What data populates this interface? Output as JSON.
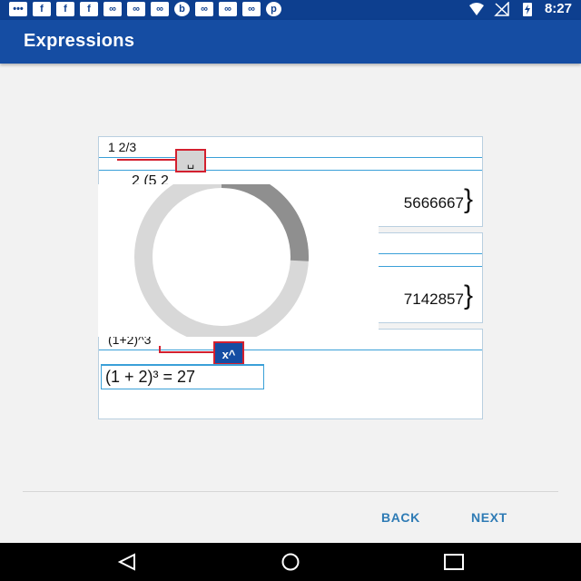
{
  "status_bar": {
    "left_icons": [
      "message-icon",
      "facebook-icon",
      "facebook-icon",
      "facebook-icon",
      "infinity-icon",
      "infinity-icon",
      "infinity-icon",
      "b-icon",
      "infinity-icon",
      "infinity-icon",
      "infinity-icon",
      "pinterest-icon"
    ],
    "time": "8:27"
  },
  "app_bar": {
    "title": "Expressions"
  },
  "cards": [
    {
      "input": "1 2/3",
      "key_label": "␣",
      "result_left": "2  (5  2",
      "result_right": "5666667"
    },
    {
      "input": "",
      "key_label": "",
      "result_left": "",
      "result_right": "7142857"
    },
    {
      "input": "(1+2)^3",
      "key_label": "x^",
      "result": "(1 + 2)³ = 27"
    }
  ],
  "buttons": {
    "back": "BACK",
    "next": "NEXT"
  },
  "colors": {
    "app_bar": "#154da3",
    "status_bar": "#0d3f8f",
    "accent_button": "#2e7bb5",
    "highlight_border": "#d3202f"
  }
}
